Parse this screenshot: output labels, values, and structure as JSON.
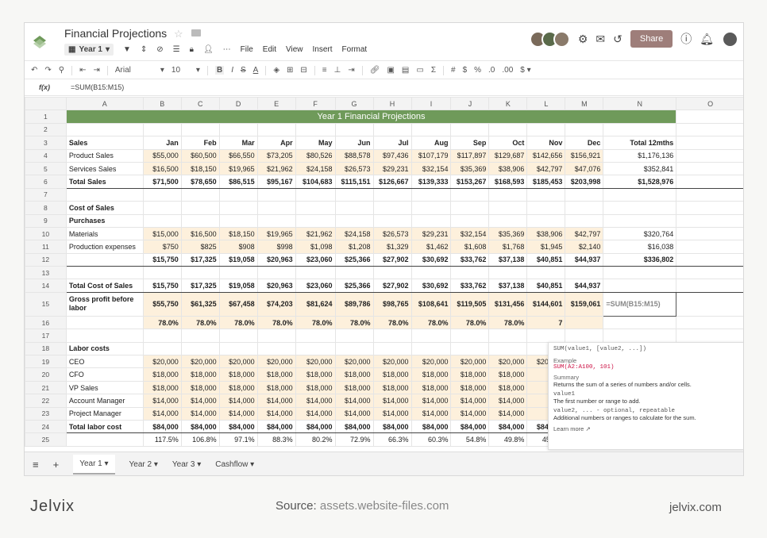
{
  "app": {
    "title": "Financial Projections",
    "sheet_selector": "Year 1",
    "menu": [
      "File",
      "Edit",
      "View",
      "Insert",
      "Format"
    ],
    "share_label": "Share",
    "font_name": "Arial",
    "font_size": "10",
    "formula_label": "f(x)",
    "formula": "=SUM(B15:M15)"
  },
  "columns": [
    "A",
    "B",
    "C",
    "D",
    "E",
    "F",
    "G",
    "H",
    "I",
    "J",
    "K",
    "L",
    "M",
    "N",
    "O"
  ],
  "rows": [
    {
      "n": "1",
      "title": "Year 1 Financial Projections"
    },
    {
      "n": "2",
      "cells": [
        "",
        "",
        "",
        "",
        "",
        "",
        "",
        "",
        "",
        "",
        "",
        "",
        "",
        "",
        ""
      ]
    },
    {
      "n": "3",
      "bold": true,
      "cells": [
        "Sales",
        "Jan",
        "Feb",
        "Mar",
        "Apr",
        "May",
        "Jun",
        "Jul",
        "Aug",
        "Sep",
        "Oct",
        "Nov",
        "Dec",
        "Total 12mths",
        ""
      ]
    },
    {
      "n": "4",
      "hl": true,
      "cells": [
        "Product Sales",
        "$55,000",
        "$60,500",
        "$66,550",
        "$73,205",
        "$80,526",
        "$88,578",
        "$97,436",
        "$107,179",
        "$117,897",
        "$129,687",
        "$142,656",
        "$156,921",
        "$1,176,136",
        ""
      ]
    },
    {
      "n": "5",
      "hl": true,
      "cells": [
        "Services Sales",
        "$16,500",
        "$18,150",
        "$19,965",
        "$21,962",
        "$24,158",
        "$26,573",
        "$29,231",
        "$32,154",
        "$35,369",
        "$38,906",
        "$42,797",
        "$47,076",
        "$352,841",
        ""
      ]
    },
    {
      "n": "6",
      "bold": true,
      "total": true,
      "cells": [
        "Total Sales",
        "$71,500",
        "$78,650",
        "$86,515",
        "$95,167",
        "$104,683",
        "$115,151",
        "$126,667",
        "$139,333",
        "$153,267",
        "$168,593",
        "$185,453",
        "$203,998",
        "$1,528,976",
        ""
      ]
    },
    {
      "n": "7",
      "cells": [
        "",
        "",
        "",
        "",
        "",
        "",
        "",
        "",
        "",
        "",
        "",
        "",
        "",
        "",
        ""
      ]
    },
    {
      "n": "8",
      "bold": true,
      "cells": [
        "Cost of Sales",
        "",
        "",
        "",
        "",
        "",
        "",
        "",
        "",
        "",
        "",
        "",
        "",
        "",
        ""
      ]
    },
    {
      "n": "9",
      "bold": true,
      "cells": [
        "Purchases",
        "",
        "",
        "",
        "",
        "",
        "",
        "",
        "",
        "",
        "",
        "",
        "",
        "",
        ""
      ]
    },
    {
      "n": "10",
      "hl": true,
      "cells": [
        "Materials",
        "$15,000",
        "$16,500",
        "$18,150",
        "$19,965",
        "$21,962",
        "$24,158",
        "$26,573",
        "$29,231",
        "$32,154",
        "$35,369",
        "$38,906",
        "$42,797",
        "$320,764",
        ""
      ]
    },
    {
      "n": "11",
      "hl": true,
      "cells": [
        "Production expenses",
        "$750",
        "$825",
        "$908",
        "$998",
        "$1,098",
        "$1,208",
        "$1,329",
        "$1,462",
        "$1,608",
        "$1,768",
        "$1,945",
        "$2,140",
        "$16,038",
        ""
      ]
    },
    {
      "n": "12",
      "bold": true,
      "total": true,
      "cells": [
        "",
        "$15,750",
        "$17,325",
        "$19,058",
        "$20,963",
        "$23,060",
        "$25,366",
        "$27,902",
        "$30,692",
        "$33,762",
        "$37,138",
        "$40,851",
        "$44,937",
        "$336,802",
        ""
      ]
    },
    {
      "n": "13",
      "cells": [
        "",
        "",
        "",
        "",
        "",
        "",
        "",
        "",
        "",
        "",
        "",
        "",
        "",
        "",
        ""
      ]
    },
    {
      "n": "14",
      "bold": true,
      "total": true,
      "cells": [
        "Total Cost of Sales",
        "$15,750",
        "$17,325",
        "$19,058",
        "$20,963",
        "$23,060",
        "$25,366",
        "$27,902",
        "$30,692",
        "$33,762",
        "$37,138",
        "$40,851",
        "$44,937",
        "",
        ""
      ]
    },
    {
      "n": "15",
      "bold": true,
      "tall": true,
      "hl": true,
      "sel": true,
      "cells": [
        "Gross profit before labor",
        "$55,750",
        "$61,325",
        "$67,458",
        "$74,203",
        "$81,624",
        "$89,786",
        "$98,765",
        "$108,641",
        "$119,505",
        "$131,456",
        "$144,601",
        "$159,061",
        "=SUM(B15:M15)",
        ""
      ]
    },
    {
      "n": "16",
      "bold": true,
      "hl": true,
      "cells": [
        "",
        "78.0%",
        "78.0%",
        "78.0%",
        "78.0%",
        "78.0%",
        "78.0%",
        "78.0%",
        "78.0%",
        "78.0%",
        "78.0%",
        "7",
        "",
        "",
        ""
      ]
    },
    {
      "n": "17",
      "cells": [
        "",
        "",
        "",
        "",
        "",
        "",
        "",
        "",
        "",
        "",
        "",
        "",
        "",
        "",
        ""
      ]
    },
    {
      "n": "18",
      "bold": true,
      "cells": [
        "Labor costs",
        "",
        "",
        "",
        "",
        "",
        "",
        "",
        "",
        "",
        "",
        "",
        "",
        "",
        ""
      ]
    },
    {
      "n": "19",
      "hl": true,
      "cells": [
        "CEO",
        "$20,000",
        "$20,000",
        "$20,000",
        "$20,000",
        "$20,000",
        "$20,000",
        "$20,000",
        "$20,000",
        "$20,000",
        "$20,000",
        "$20,000",
        "",
        "",
        ""
      ]
    },
    {
      "n": "20",
      "hl": true,
      "cells": [
        "CFO",
        "$18,000",
        "$18,000",
        "$18,000",
        "$18,000",
        "$18,000",
        "$18,000",
        "$18,000",
        "$18,000",
        "$18,000",
        "$18,000",
        "$1",
        "",
        "",
        ""
      ]
    },
    {
      "n": "21",
      "hl": true,
      "cells": [
        "VP Sales",
        "$18,000",
        "$18,000",
        "$18,000",
        "$18,000",
        "$18,000",
        "$18,000",
        "$18,000",
        "$18,000",
        "$18,000",
        "$18,000",
        "$1",
        "",
        "",
        ""
      ]
    },
    {
      "n": "22",
      "hl": true,
      "cells": [
        "Account Manager",
        "$14,000",
        "$14,000",
        "$14,000",
        "$14,000",
        "$14,000",
        "$14,000",
        "$14,000",
        "$14,000",
        "$14,000",
        "$14,000",
        "$1",
        "",
        "",
        ""
      ]
    },
    {
      "n": "23",
      "hl": true,
      "cells": [
        "Project Manager",
        "$14,000",
        "$14,000",
        "$14,000",
        "$14,000",
        "$14,000",
        "$14,000",
        "$14,000",
        "$14,000",
        "$14,000",
        "$14,000",
        "$1",
        "",
        "",
        ""
      ]
    },
    {
      "n": "24",
      "bold": true,
      "total": true,
      "cells": [
        "Total labor cost",
        "$84,000",
        "$84,000",
        "$84,000",
        "$84,000",
        "$84,000",
        "$84,000",
        "$84,000",
        "$84,000",
        "$84,000",
        "$84,000",
        "$84,000",
        "$84,000",
        "$1,008,000",
        ""
      ]
    },
    {
      "n": "25",
      "cells": [
        "",
        "117.5%",
        "106.8%",
        "97.1%",
        "88.3%",
        "80.2%",
        "72.9%",
        "66.3%",
        "60.3%",
        "54.8%",
        "49.8%",
        "45.3%",
        "41.2%",
        "",
        ""
      ]
    }
  ],
  "popup": {
    "signature": "SUM(value1, [value2, ...])",
    "example_label": "Example",
    "example": "SUM(A2:A100, 101)",
    "summary_label": "Summary",
    "summary": "Returns the sum of a series of numbers and/or cells.",
    "arg1": "value1",
    "arg1_desc": "The first number or range to add.",
    "arg2": "value2, ... - optional, repeatable",
    "arg2_desc": "Additional numbers or ranges to calculate for the sum.",
    "learn_more": "Learn more"
  },
  "tabs": [
    "Year 1",
    "Year 2",
    "Year 3",
    "Cashflow"
  ],
  "footer": {
    "brand": "Jelvix",
    "source_label": "Source:",
    "source": "assets.website-files.com",
    "url": "jelvix.com"
  },
  "colors": {
    "title_bg": "#6f9a5a",
    "highlight": "#fdf0dc",
    "share": "#9e7e7a"
  }
}
